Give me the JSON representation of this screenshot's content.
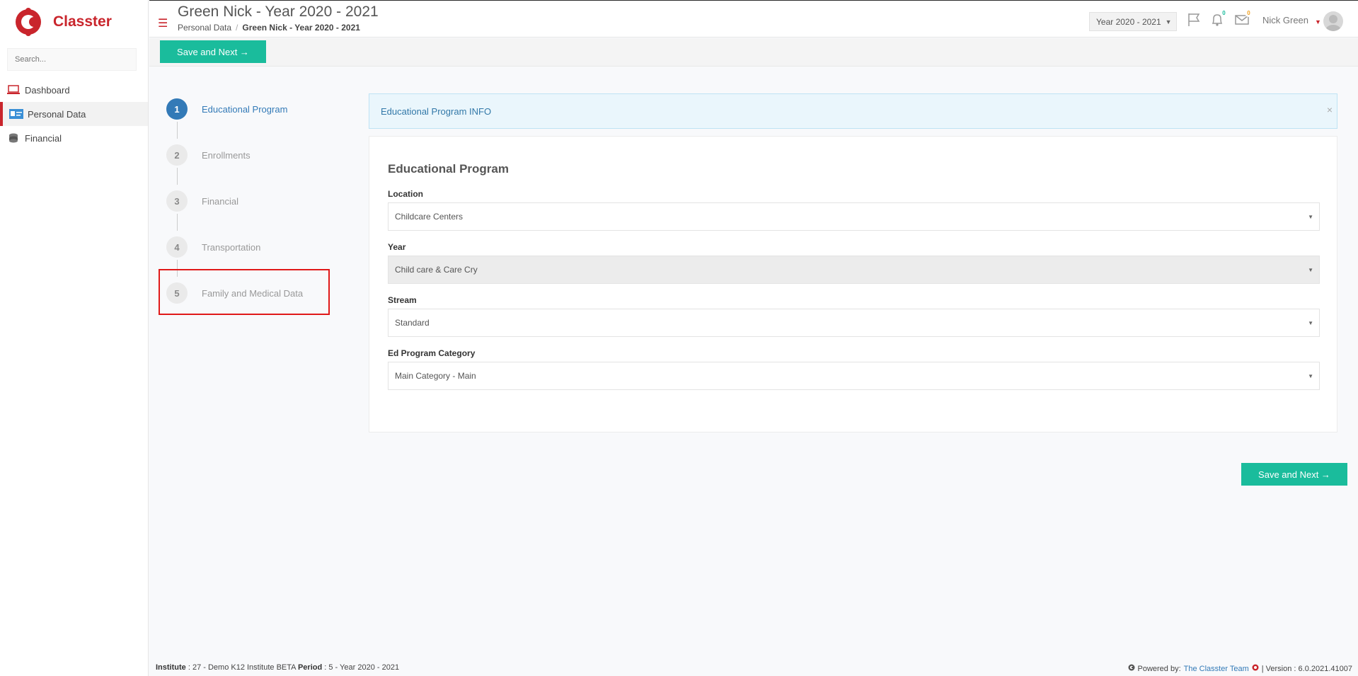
{
  "app": {
    "name": "Classter"
  },
  "sidebar": {
    "search_placeholder": "Search...",
    "items": [
      {
        "label": "Dashboard",
        "icon": "laptop-icon"
      },
      {
        "label": "Personal Data",
        "icon": "id-card-icon"
      },
      {
        "label": "Financial",
        "icon": "coins-icon"
      }
    ]
  },
  "header": {
    "title": "Green Nick - Year 2020 - 2021",
    "breadcrumb": {
      "parent": "Personal Data",
      "separator": "/",
      "current": "Green Nick - Year 2020 - 2021"
    },
    "year_select": "Year 2020 - 2021",
    "flag_icon": "flag-icon",
    "notifications_count": "0",
    "messages_count": "0",
    "user_name": "Nick Green"
  },
  "actions": {
    "save_next_label": "Save and Next →"
  },
  "steps": [
    {
      "num": "1",
      "label": "Educational Program",
      "active": true
    },
    {
      "num": "2",
      "label": "Enrollments",
      "active": false
    },
    {
      "num": "3",
      "label": "Financial",
      "active": false
    },
    {
      "num": "4",
      "label": "Transportation",
      "active": false
    },
    {
      "num": "5",
      "label": "Family and Medical Data",
      "active": false
    }
  ],
  "info": {
    "text": "Educational Program INFO",
    "close": "×"
  },
  "form": {
    "title": "Educational Program",
    "fields": [
      {
        "label": "Location",
        "value": "Childcare Centers",
        "disabled": false
      },
      {
        "label": "Year",
        "value": "Child care & Care Cry",
        "disabled": true
      },
      {
        "label": "Stream",
        "value": "Standard",
        "disabled": false
      },
      {
        "label": "Ed Program Category",
        "value": "Main Category - Main",
        "disabled": false
      }
    ]
  },
  "footer": {
    "institute_label": "Institute",
    "institute_value": ": 27 - Demo K12 Institute BETA",
    "period_label": "Period",
    "period_value": ": 5 - Year 2020 - 2021",
    "powered_by": "Powered by:",
    "team": "The Classter Team",
    "version": "| Version : 6.0.2021.41007"
  },
  "colors": {
    "brand": "#c9252c",
    "accent": "#1abc9c",
    "active_step": "#337ab7",
    "highlight": "#e01919"
  }
}
